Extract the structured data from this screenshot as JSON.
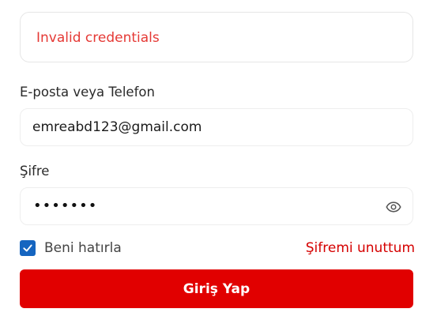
{
  "alert": {
    "message": "Invalid credentials",
    "color": "#e53935"
  },
  "form": {
    "email_label": "E-posta veya Telefon",
    "email_value": "emreabd123@gmail.com",
    "password_label": "Şifre",
    "password_mask": "•••••••",
    "show_password_icon": "eye-icon",
    "remember_label": "Beni hatırla",
    "remember_checked": true,
    "forgot_link": "Şifremi unuttum",
    "submit_label": "Giriş Yap"
  },
  "colors": {
    "primary_button": "#e10000",
    "link": "#d50000",
    "checkbox": "#1565c0",
    "field_border": "#eeeeee"
  }
}
